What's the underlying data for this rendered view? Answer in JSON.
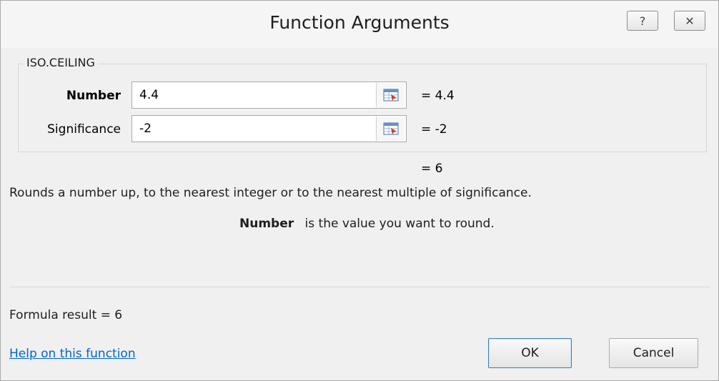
{
  "dialog": {
    "title": "Function Arguments",
    "help_glyph": "?",
    "close_glyph": "✕"
  },
  "function": {
    "name": "ISO.CEILING",
    "args": [
      {
        "label": "Number",
        "value": "4.4",
        "result": "=  4.4",
        "bold": true
      },
      {
        "label": "Significance",
        "value": "-2",
        "result": "=  -2",
        "bold": false
      }
    ],
    "overall_result": "=  6",
    "description": "Rounds a number up, to the nearest integer or to the nearest multiple of significance.",
    "arg_description_name": "Number",
    "arg_description_text": "is the value you want to round."
  },
  "footer": {
    "formula_result": "Formula result =   6",
    "help_link": "Help on this function",
    "ok_label": "OK",
    "cancel_label": "Cancel"
  },
  "icons": {
    "title_help": "question-icon",
    "title_close": "close-icon",
    "ref_picker": "collapse-dialog-icon"
  },
  "colors": {
    "dialog_bg": "#f0f0f0",
    "link": "#0066cc",
    "default_button_border": "#3c7fb1"
  }
}
